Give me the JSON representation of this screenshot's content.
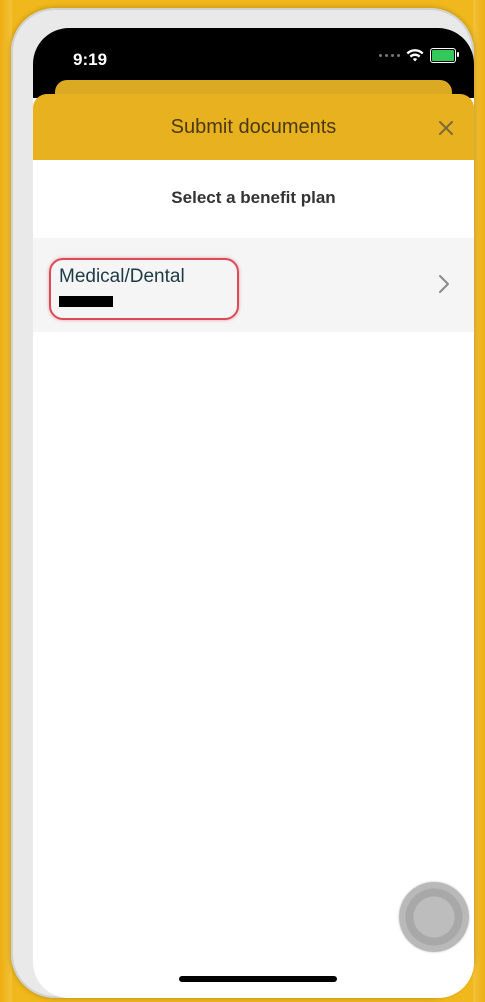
{
  "status_bar": {
    "time": "9:19"
  },
  "header": {
    "title": "Submit documents"
  },
  "content": {
    "heading": "Select a benefit plan",
    "plans": [
      {
        "name": "Medical/Dental"
      }
    ]
  },
  "icons": {
    "close": "close-icon",
    "chevron": "chevron-right-icon",
    "wifi": "wifi-icon",
    "battery": "battery-charging-icon"
  },
  "colors": {
    "header_bg": "#e7b120",
    "frame_bg": "#f0b81c",
    "plan_text": "#1d3a46",
    "highlight": "#d94b57",
    "battery": "#34c759"
  }
}
